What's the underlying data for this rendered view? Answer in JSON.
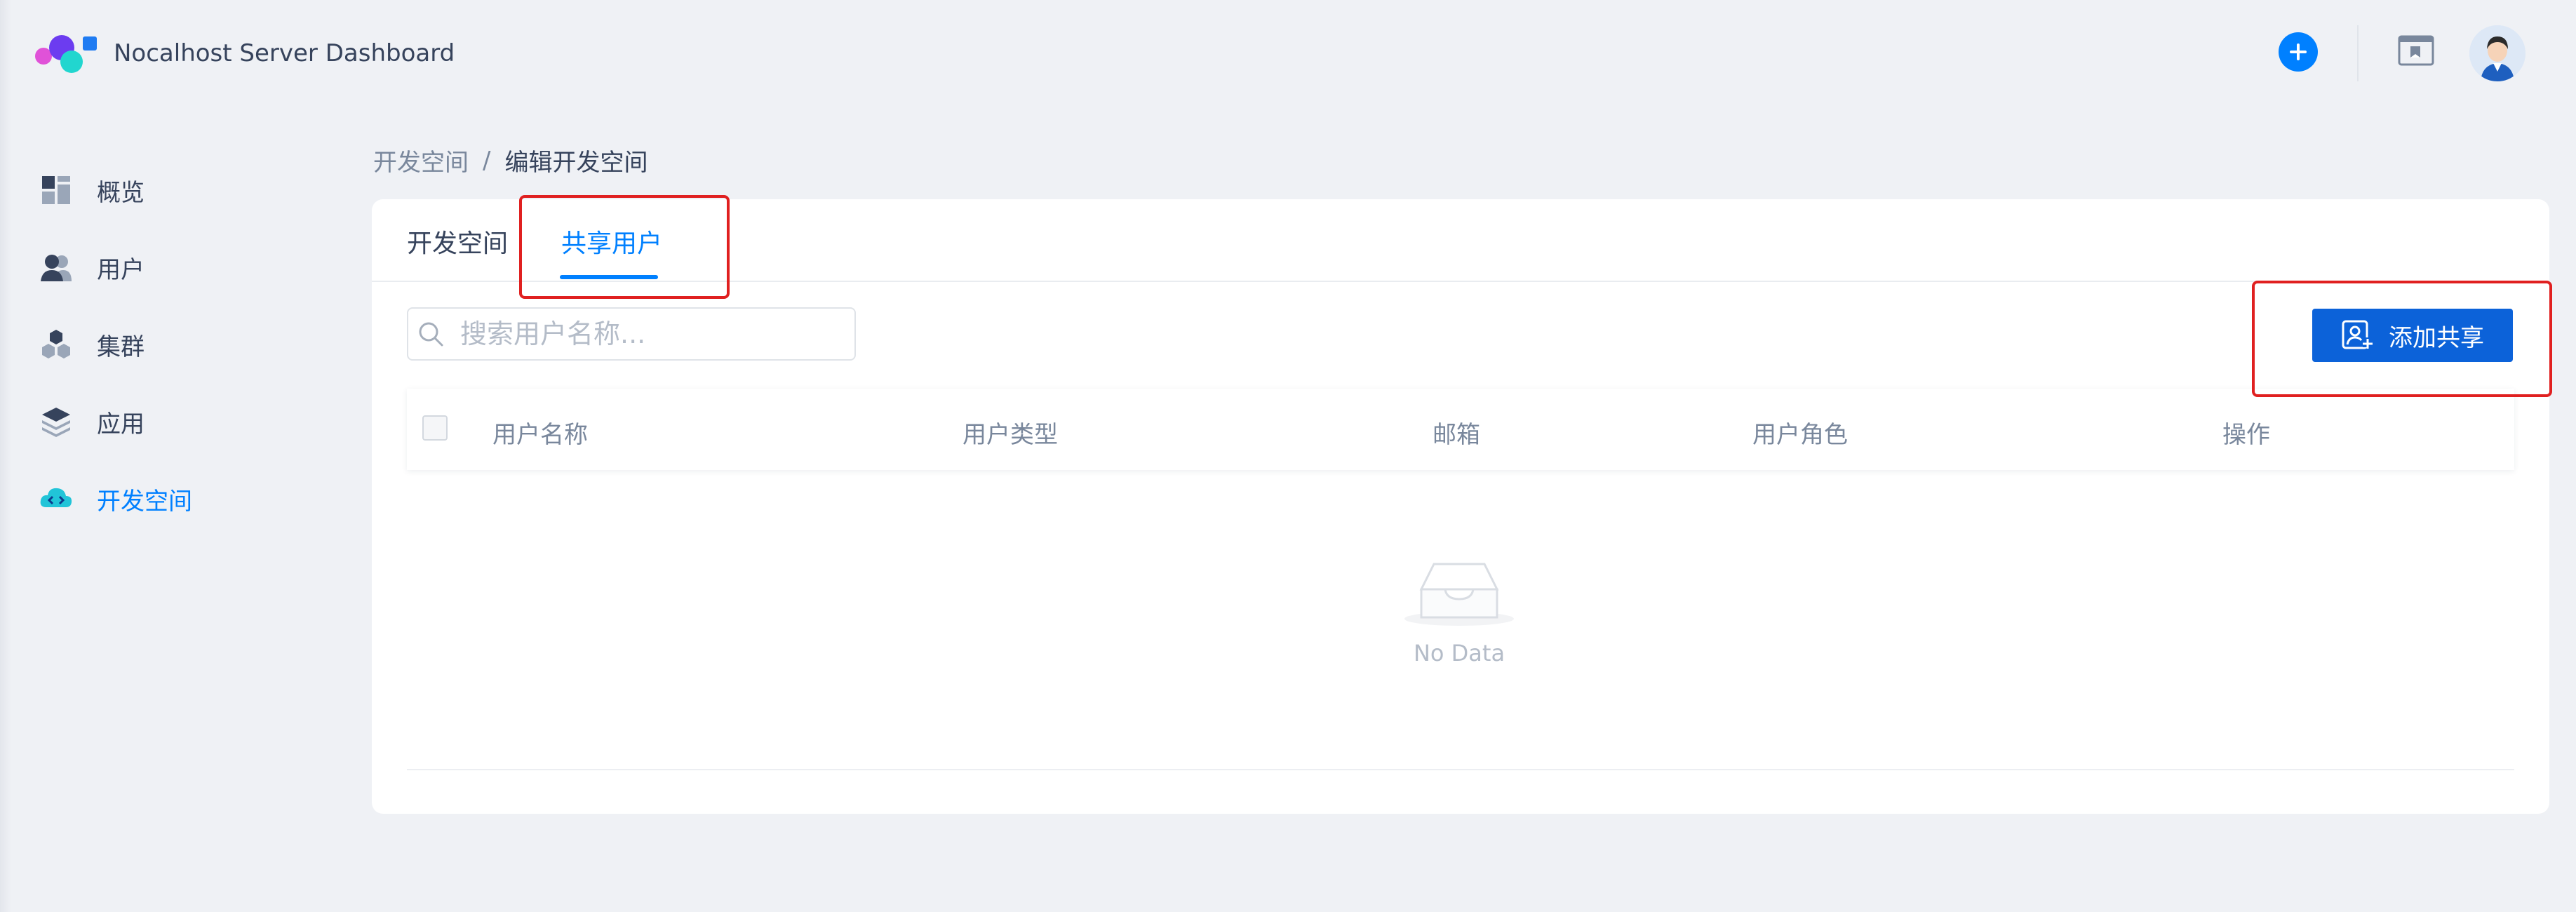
{
  "app": {
    "title": "Nocalhost Server Dashboard"
  },
  "header": {
    "add_icon": "plus-circle-icon",
    "window_icon": "browser-window-icon",
    "avatar_icon": "user-avatar-icon"
  },
  "sidebar": {
    "items": [
      {
        "label": "概览",
        "icon": "dashboard-grid-icon",
        "active": false
      },
      {
        "label": "用户",
        "icon": "users-icon",
        "active": false
      },
      {
        "label": "集群",
        "icon": "cluster-icon",
        "active": false
      },
      {
        "label": "应用",
        "icon": "layers-icon",
        "active": false
      },
      {
        "label": "开发空间",
        "icon": "cloud-code-icon",
        "active": true
      }
    ]
  },
  "breadcrumb": {
    "parent": "开发空间",
    "separator": "/",
    "current": "编辑开发空间"
  },
  "tabs": [
    {
      "label": "开发空间",
      "active": false
    },
    {
      "label": "共享用户",
      "active": true
    }
  ],
  "search": {
    "placeholder": "搜索用户名称...",
    "value": ""
  },
  "add_share_button": {
    "label": "添加共享",
    "icon": "add-user-icon"
  },
  "table": {
    "columns": [
      "用户名称",
      "用户类型",
      "邮箱",
      "用户角色",
      "操作"
    ],
    "rows": []
  },
  "empty_state": {
    "text": "No Data",
    "icon": "empty-inbox-icon"
  },
  "colors": {
    "accent": "#0080ff",
    "button": "#0c62d9",
    "highlight": "#e02020",
    "background": "#eff1f5"
  }
}
